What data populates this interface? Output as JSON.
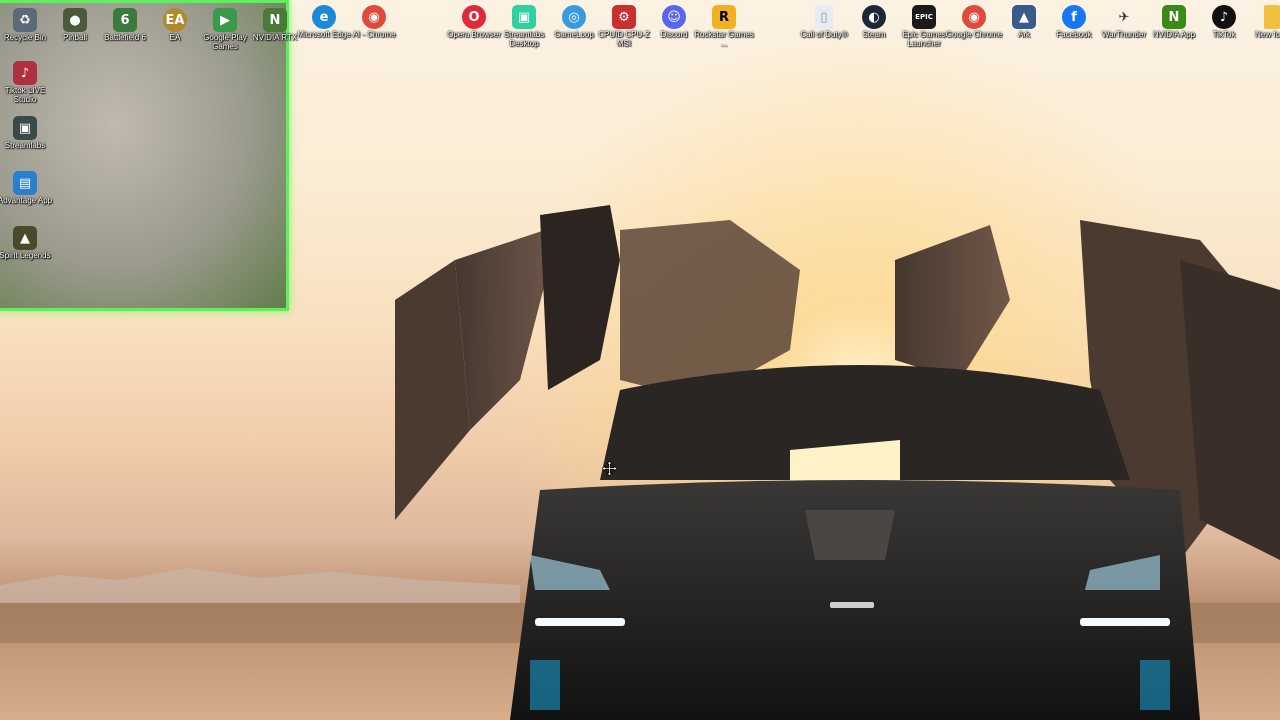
{
  "colors": {
    "selection_border": "#5cf05a",
    "label_text": "#ffffff"
  },
  "selected_icons": [
    {
      "label": "Recycle Bin",
      "icon": "recycle-bin-icon",
      "color": "#5a6a78"
    },
    {
      "label": "Pinball",
      "icon": "pinball-icon",
      "color": "#4a5a3a"
    },
    {
      "label": "Battlefield 6",
      "icon": "battlefield-icon",
      "color": "#3a7a3a"
    },
    {
      "label": "EA",
      "icon": "ea-icon",
      "color": "#b08a2a"
    },
    {
      "label": "Google Play Games",
      "icon": "google-play-games-icon",
      "color": "#3a9a4a"
    },
    {
      "label": "NVIDIA RTX",
      "icon": "nvidia-rtx-icon",
      "color": "#4a7a3a"
    },
    {
      "label": "Tiktok LIVE Studio",
      "icon": "tiktok-live-studio-icon",
      "color": "#b03040"
    },
    {
      "label": "Streamlabs",
      "icon": "streamlabs-icon",
      "color": "#3a4a4a"
    },
    {
      "label": "Advantage App",
      "icon": "advantage-app-icon",
      "color": "#2a80d0"
    },
    {
      "label": "Spirit Legends",
      "icon": "spirit-legends-icon",
      "color": "#4a4a2a"
    }
  ],
  "desktop_icons": [
    {
      "label": "Microsoft Edge",
      "icon": "microsoft-edge-icon",
      "color": "#1a8ad8"
    },
    {
      "label": "AI - Chrome",
      "icon": "chrome-ai-icon",
      "color": "#e04a3a"
    },
    {
      "label": "Opera Browser",
      "icon": "opera-icon",
      "color": "#e02a3a"
    },
    {
      "label": "Streamlabs Desktop",
      "icon": "streamlabs-desktop-icon",
      "color": "#30d0a0"
    },
    {
      "label": "GameLoop",
      "icon": "gameloop-icon",
      "color": "#3a9ae0"
    },
    {
      "label": "CPUID CPU-Z MSI",
      "icon": "cpuid-icon",
      "color": "#c83030"
    },
    {
      "label": "Discord",
      "icon": "discord-icon",
      "color": "#5865f2"
    },
    {
      "label": "Rockstar Games ...",
      "icon": "rockstar-games-icon",
      "color": "#f0b020"
    },
    {
      "label": "Call of Duty®",
      "icon": "file-icon",
      "color": "#e8ecf0"
    },
    {
      "label": "Steam",
      "icon": "steam-icon",
      "color": "#1b2838"
    },
    {
      "label": "Epic Games Launcher",
      "icon": "epic-games-icon",
      "color": "#1a1a1a"
    },
    {
      "label": "Google Chrome",
      "icon": "google-chrome-icon",
      "color": "#e04a3a"
    },
    {
      "label": "Ark",
      "icon": "ark-icon",
      "color": "#3a5a8a"
    },
    {
      "label": "Facebook",
      "icon": "facebook-icon",
      "color": "#1877f2"
    },
    {
      "label": "WarThunder",
      "icon": "warthunder-icon",
      "color": "#444444"
    },
    {
      "label": "NVIDIA App",
      "icon": "nvidia-app-icon",
      "color": "#3a8a1a"
    },
    {
      "label": "TikTok",
      "icon": "tiktok-icon",
      "color": "#111111"
    },
    {
      "label": "New fo",
      "icon": "folder-icon",
      "color": "#f0c040"
    }
  ]
}
